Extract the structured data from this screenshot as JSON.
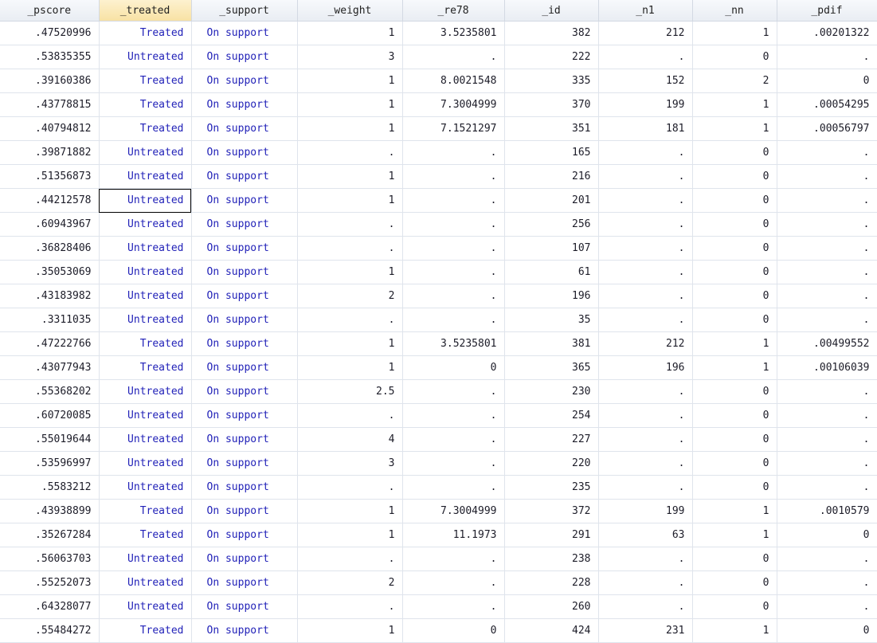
{
  "columns": [
    "_pscore",
    "_treated",
    "_support",
    "_weight",
    "_re78",
    "_id",
    "_n1",
    "_nn",
    "_pdif"
  ],
  "selected_column": 1,
  "active_cell": {
    "row": 7,
    "col": 1
  },
  "rows": [
    [
      ".47520996",
      "Treated",
      "On support",
      "1",
      "3.5235801",
      "382",
      "212",
      "1",
      ".00201322"
    ],
    [
      ".53835355",
      "Untreated",
      "On support",
      "3",
      ".",
      "222",
      ".",
      "0",
      "."
    ],
    [
      ".39160386",
      "Treated",
      "On support",
      "1",
      "8.0021548",
      "335",
      "152",
      "2",
      "0"
    ],
    [
      ".43778815",
      "Treated",
      "On support",
      "1",
      "7.3004999",
      "370",
      "199",
      "1",
      ".00054295"
    ],
    [
      ".40794812",
      "Treated",
      "On support",
      "1",
      "7.1521297",
      "351",
      "181",
      "1",
      ".00056797"
    ],
    [
      ".39871882",
      "Untreated",
      "On support",
      ".",
      ".",
      "165",
      ".",
      "0",
      "."
    ],
    [
      ".51356873",
      "Untreated",
      "On support",
      "1",
      ".",
      "216",
      ".",
      "0",
      "."
    ],
    [
      ".44212578",
      "Untreated",
      "On support",
      "1",
      ".",
      "201",
      ".",
      "0",
      "."
    ],
    [
      ".60943967",
      "Untreated",
      "On support",
      ".",
      ".",
      "256",
      ".",
      "0",
      "."
    ],
    [
      ".36828406",
      "Untreated",
      "On support",
      ".",
      ".",
      "107",
      ".",
      "0",
      "."
    ],
    [
      ".35053069",
      "Untreated",
      "On support",
      "1",
      ".",
      "61",
      ".",
      "0",
      "."
    ],
    [
      ".43183982",
      "Untreated",
      "On support",
      "2",
      ".",
      "196",
      ".",
      "0",
      "."
    ],
    [
      ".3311035",
      "Untreated",
      "On support",
      ".",
      ".",
      "35",
      ".",
      "0",
      "."
    ],
    [
      ".47222766",
      "Treated",
      "On support",
      "1",
      "3.5235801",
      "381",
      "212",
      "1",
      ".00499552"
    ],
    [
      ".43077943",
      "Treated",
      "On support",
      "1",
      "0",
      "365",
      "196",
      "1",
      ".00106039"
    ],
    [
      ".55368202",
      "Untreated",
      "On support",
      "2.5",
      ".",
      "230",
      ".",
      "0",
      "."
    ],
    [
      ".60720085",
      "Untreated",
      "On support",
      ".",
      ".",
      "254",
      ".",
      "0",
      "."
    ],
    [
      ".55019644",
      "Untreated",
      "On support",
      "4",
      ".",
      "227",
      ".",
      "0",
      "."
    ],
    [
      ".53596997",
      "Untreated",
      "On support",
      "3",
      ".",
      "220",
      ".",
      "0",
      "."
    ],
    [
      ".5583212",
      "Untreated",
      "On support",
      ".",
      ".",
      "235",
      ".",
      "0",
      "."
    ],
    [
      ".43938899",
      "Treated",
      "On support",
      "1",
      "7.3004999",
      "372",
      "199",
      "1",
      ".0010579"
    ],
    [
      ".35267284",
      "Treated",
      "On support",
      "1",
      "11.1973",
      "291",
      "63",
      "1",
      "0"
    ],
    [
      ".56063703",
      "Untreated",
      "On support",
      ".",
      ".",
      "238",
      ".",
      "0",
      "."
    ],
    [
      ".55252073",
      "Untreated",
      "On support",
      "2",
      ".",
      "228",
      ".",
      "0",
      "."
    ],
    [
      ".64328077",
      "Untreated",
      "On support",
      ".",
      ".",
      "260",
      ".",
      "0",
      "."
    ],
    [
      ".55484272",
      "Treated",
      "On support",
      "1",
      "0",
      "424",
      "231",
      "1",
      "0"
    ]
  ]
}
